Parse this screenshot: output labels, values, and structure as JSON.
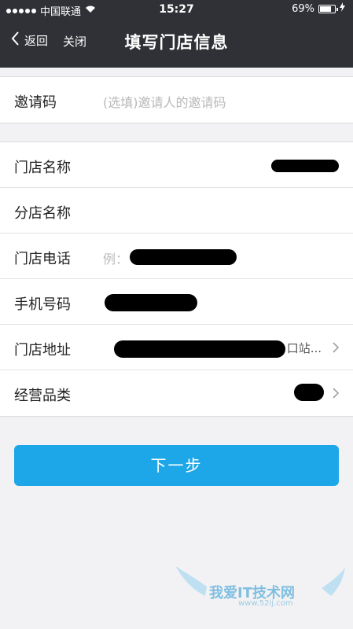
{
  "status": {
    "carrier": "中国联通",
    "time": "15:27",
    "battery": "69%",
    "battery_level": 0.69
  },
  "nav": {
    "back": "返回",
    "close": "关闭",
    "title": "填写门店信息"
  },
  "invite": {
    "label": "邀请码",
    "placeholder": "(选填)邀请人的邀请码"
  },
  "form": {
    "store_name": {
      "label": "门店名称"
    },
    "branch_name": {
      "label": "分店名称"
    },
    "store_phone": {
      "label": "门店电话",
      "placeholder": "例："
    },
    "mobile": {
      "label": "手机号码"
    },
    "address": {
      "label": "门店地址",
      "suffix": "口站..."
    },
    "category": {
      "label": "经营品类"
    }
  },
  "next_button": "下一步",
  "watermark": {
    "text": "我爱IT技术网",
    "url": "www.52ij.com"
  },
  "colors": {
    "topbar": "#2f3136",
    "accent": "#1ea7e8",
    "background": "#f2f2f4"
  }
}
